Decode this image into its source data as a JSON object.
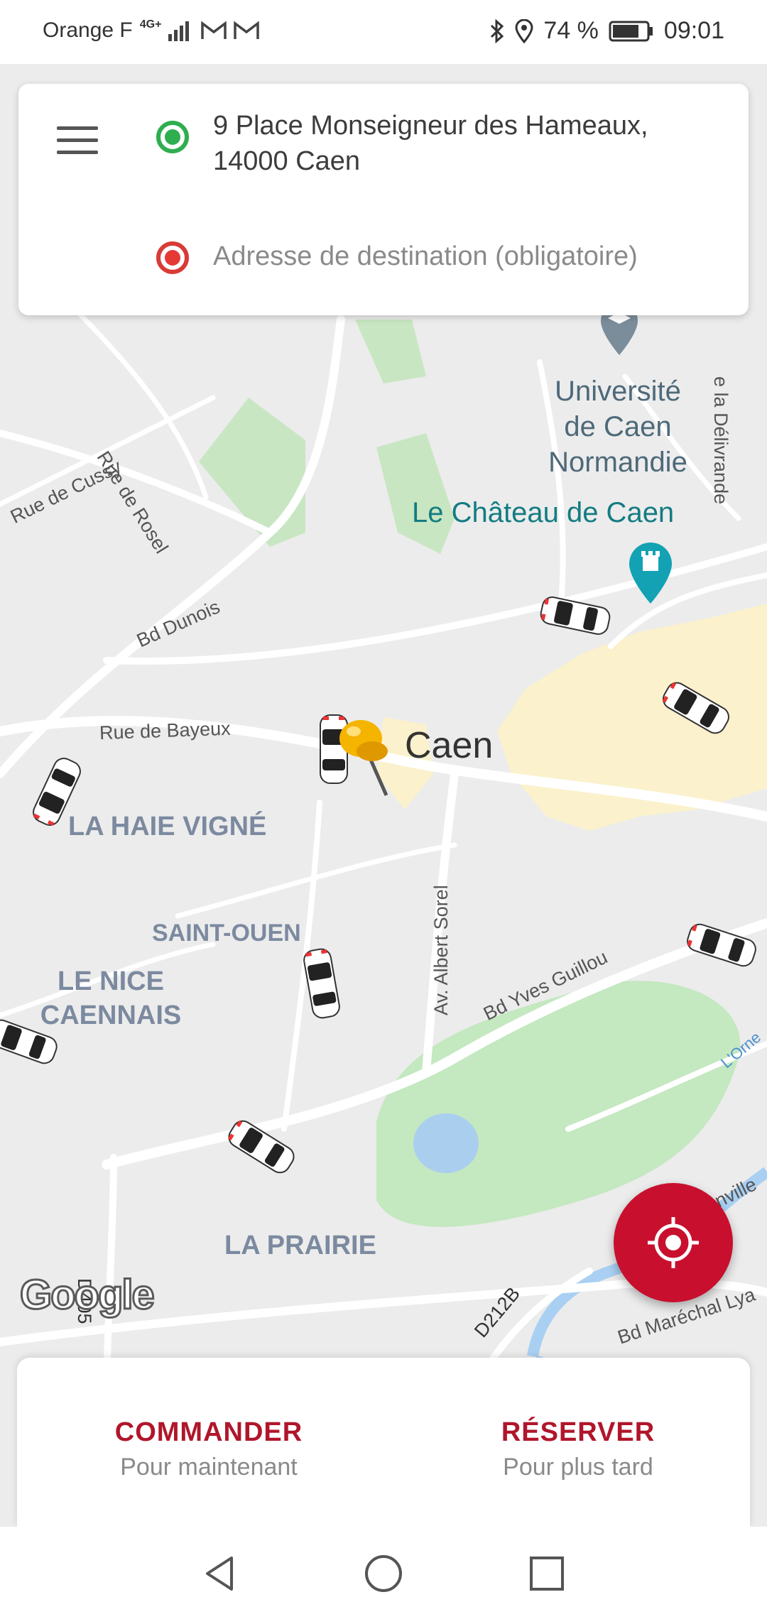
{
  "status_bar": {
    "carrier": "Orange F",
    "network": "4G+",
    "battery_percent": "74 %",
    "time": "09:01"
  },
  "top_card": {
    "origin_address": "9 Place Monseigneur des Hameaux, 14000 Caen",
    "destination_placeholder": "Adresse de destination (obligatoire)"
  },
  "map": {
    "city_label": "Caen",
    "districts": {
      "haie_vigne": "LA HAIE VIGNÉ",
      "saint_ouen": "SAINT-OUEN",
      "le_nice_caennais": "LE NICE CAENNAIS",
      "la_prairie": "LA PRAIRIE"
    },
    "streets": {
      "rue_de_rosel": "Rue de Rosel",
      "rue_de_cussy": "Rue de Cussy",
      "bd_dunois": "Bd Dunois",
      "rue_de_bayeux": "Rue de Bayeux",
      "av_albert_sorel": "Av. Albert Sorel",
      "bd_yves_guillou": "Bd Yves Guillou",
      "d405": "D405",
      "d212b": "D212B",
      "bd_marechal_lyautey": "Bd Maréchal Lya",
      "rue_de_la_delivrande": "e la Délivrande",
      "granville": "ranville",
      "lorne": "L'Orne"
    },
    "pois": {
      "universite": "Université de Caen Normandie",
      "chateau": "Le Château de Caen"
    },
    "attribution": "Google"
  },
  "bottom_card": {
    "order_now_label": "COMMANDER",
    "order_now_sub": "Pour maintenant",
    "book_label": "RÉSERVER",
    "book_sub": "Pour plus tard"
  },
  "colors": {
    "brand_red": "#c8102e",
    "origin_green": "#2fae4f",
    "destination_red": "#e53935"
  }
}
